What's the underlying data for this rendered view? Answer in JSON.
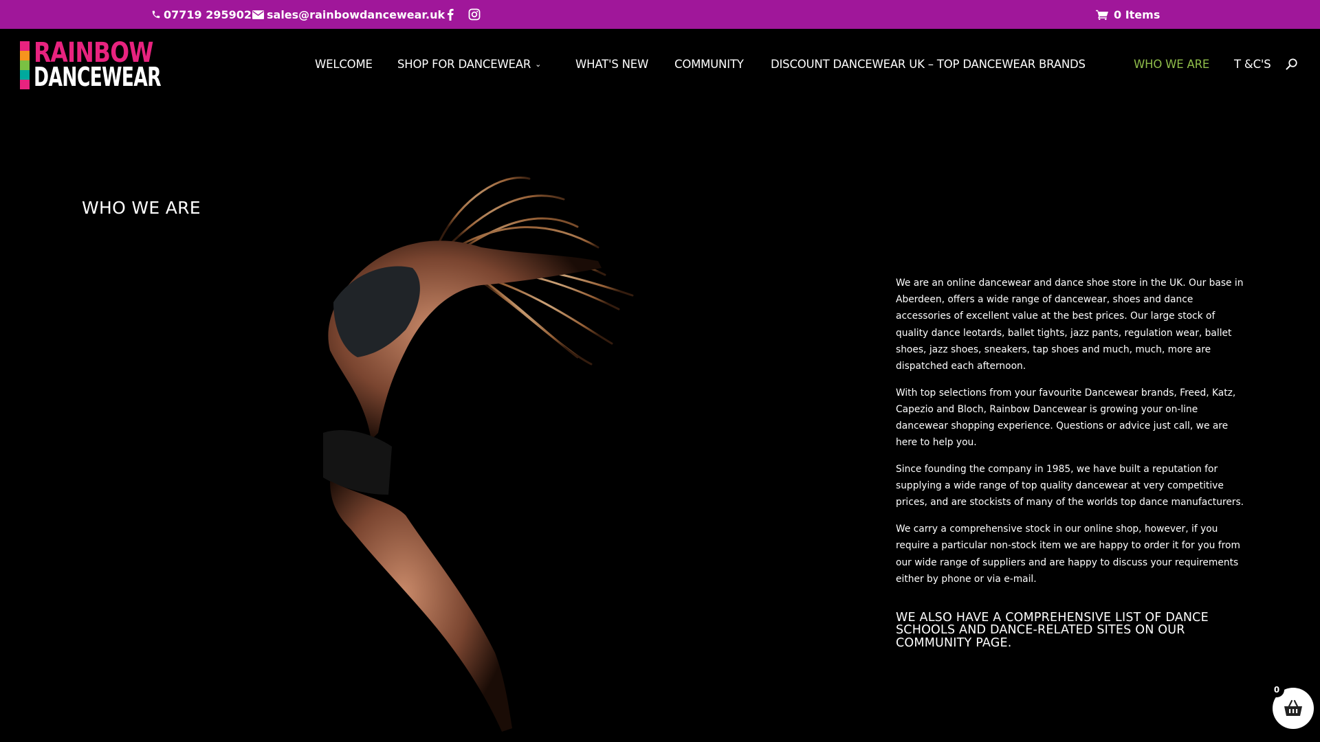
{
  "topbar": {
    "phone": "07719 295902",
    "email": "sales@rainbowdancewear.uk",
    "cart_label": "0 Items"
  },
  "logo": {
    "line1": "RAINBOW",
    "line2": "DANCEWEAR",
    "bar_colors": [
      "#e8237f",
      "#f7941d",
      "#7ac143",
      "#00a99d",
      "#e8237f"
    ]
  },
  "nav": {
    "items": [
      {
        "label": "WELCOME"
      },
      {
        "label": "SHOP FOR DANCEWEAR"
      },
      {
        "label": "WHAT'S NEW"
      },
      {
        "label": "COMMUNITY"
      },
      {
        "label": "DISCOUNT DANCEWEAR UK – TOP DANCEWEAR BRANDS"
      },
      {
        "label": "WHO WE ARE"
      },
      {
        "label": "T &C'S"
      }
    ]
  },
  "main": {
    "title": "WHO WE ARE",
    "paragraphs": [
      "We are an online dancewear and dance shoe store in the UK. Our base in Aberdeen, offers a wide range of dancewear, shoes and dance accessories of excellent value at the best prices. Our large stock of quality dance leotards, ballet tights,  jazz pants, regulation wear, ballet shoes, jazz shoes,  sneakers, tap shoes and much, much, more are dispatched each afternoon.",
      "With top selections from your favourite Dancewear brands, Freed, Katz, Capezio and Bloch, Rainbow Dancewear is growing your on-line dancewear shopping experience. Questions or advice just call, we are here to help you.",
      "Since founding the company in 1985, we have built a reputation for supplying a wide range of top quality dancewear at very competitive prices, and are stockists of many of the worlds top dance manufacturers.",
      "We carry a comprehensive stock in our online shop, however, if you require a particular non-stock item we are happy to order it for you from our wide range of suppliers and are happy to discuss your requirements either by phone or via e-mail."
    ],
    "community_heading": "WE ALSO HAVE A COMPREHENSIVE LIST OF DANCE SCHOOLS AND DANCE-RELATED SITES ON OUR COMMUNITY PAGE."
  },
  "floating_cart": {
    "count": "0"
  },
  "colors": {
    "topbar_bg": "#a0179a",
    "nav_active": "#8fbd4a",
    "logo_pink": "#e8237f"
  }
}
